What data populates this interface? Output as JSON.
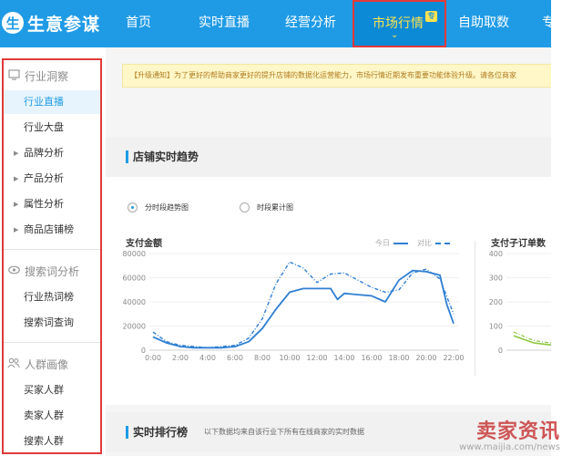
{
  "app": {
    "logo_mark": "生",
    "logo_text": "生意参谋"
  },
  "nav": {
    "items": [
      "首页",
      "实时直播",
      "经营分析",
      "市场行情",
      "自助取数",
      "专"
    ],
    "active_badge": "专",
    "active_chevron": "⌄"
  },
  "sidebar": {
    "sections": [
      {
        "icon": "monitor-icon",
        "title": "行业洞察",
        "items": [
          {
            "label": "行业直播",
            "active": true,
            "caret": false
          },
          {
            "label": "行业大盘",
            "active": false,
            "caret": false
          },
          {
            "label": "品牌分析",
            "active": false,
            "caret": true
          },
          {
            "label": "产品分析",
            "active": false,
            "caret": true
          },
          {
            "label": "属性分析",
            "active": false,
            "caret": true
          },
          {
            "label": "商品店铺榜",
            "active": false,
            "caret": true
          }
        ]
      },
      {
        "icon": "eye-icon",
        "title": "搜索词分析",
        "items": [
          {
            "label": "行业热词榜",
            "active": false,
            "caret": false
          },
          {
            "label": "搜索词查询",
            "active": false,
            "caret": false
          }
        ]
      },
      {
        "icon": "people-icon",
        "title": "人群画像",
        "items": [
          {
            "label": "买家人群",
            "active": false,
            "caret": false
          },
          {
            "label": "卖家人群",
            "active": false,
            "caret": false
          },
          {
            "label": "搜索人群",
            "active": false,
            "caret": false
          }
        ]
      }
    ]
  },
  "notice": "【升级通知】为了更好的帮助商家更好的提升店铺的数据化运营能力，市场行情近期发布重要功能体验升级。请各位商家",
  "realtime_trend": {
    "title": "店铺实时趋势",
    "radios": [
      {
        "label": "分时段趋势图",
        "checked": true
      },
      {
        "label": "时段累计图",
        "checked": false
      }
    ]
  },
  "ranking": {
    "title": "实时排行榜",
    "subtitle": "以下数据均来自该行业下所有在线商家的实时数据"
  },
  "watermark": {
    "title": "卖家资讯",
    "url": "www.maijia.com/news"
  },
  "colors": {
    "brand": "#1f9be6",
    "highlight": "#fde34d",
    "line": "#2f7fd3",
    "line_green": "#8cc63f"
  },
  "chart_data": [
    {
      "type": "line",
      "title": "支付金额",
      "legend": [
        "今日",
        "对比"
      ],
      "x_ticks": [
        "0:00",
        "2:00",
        "4:00",
        "6:00",
        "8:00",
        "10:00",
        "12:00",
        "14:00",
        "16:00",
        "18:00",
        "20:00",
        "22:00"
      ],
      "ylim": [
        0,
        80000
      ],
      "y_ticks": [
        "0",
        "20000",
        "40000",
        "60000",
        "80000"
      ],
      "series": [
        {
          "name": "今日",
          "style": "solid",
          "x": [
            0,
            1,
            2,
            3,
            4,
            5,
            6,
            7,
            8,
            9,
            10,
            11,
            12,
            13,
            13.5,
            14,
            15,
            16,
            17,
            18,
            19,
            20,
            21,
            21.5,
            22
          ],
          "values": [
            11000,
            6000,
            3000,
            2000,
            2000,
            2000,
            3000,
            7000,
            18000,
            34000,
            48000,
            51000,
            51000,
            51000,
            42000,
            47000,
            46000,
            45000,
            40000,
            58000,
            66000,
            65000,
            62000,
            38000,
            22000
          ]
        },
        {
          "name": "对比",
          "style": "dash",
          "x": [
            0,
            1,
            2,
            3,
            4,
            5,
            6,
            7,
            8,
            9,
            10,
            11,
            12,
            13,
            14,
            15,
            16,
            17,
            18,
            19,
            20,
            21,
            22
          ],
          "values": [
            15000,
            7000,
            4000,
            3000,
            2000,
            3000,
            4000,
            10000,
            26000,
            55000,
            73000,
            68000,
            56000,
            63000,
            64000,
            58000,
            52000,
            48000,
            50000,
            64000,
            67000,
            59000,
            30000
          ]
        }
      ]
    },
    {
      "type": "line",
      "title": "支付子订单数",
      "y_ticks": [
        "0",
        "100",
        "200",
        "300",
        "400"
      ],
      "ylim": [
        0,
        400
      ],
      "series": [
        {
          "name": "今日",
          "style": "solid",
          "x": [
            0,
            1,
            2
          ],
          "values": [
            60,
            30,
            20
          ]
        },
        {
          "name": "对比",
          "style": "dash",
          "x": [
            0,
            1,
            2
          ],
          "values": [
            75,
            40,
            28
          ]
        }
      ]
    }
  ]
}
